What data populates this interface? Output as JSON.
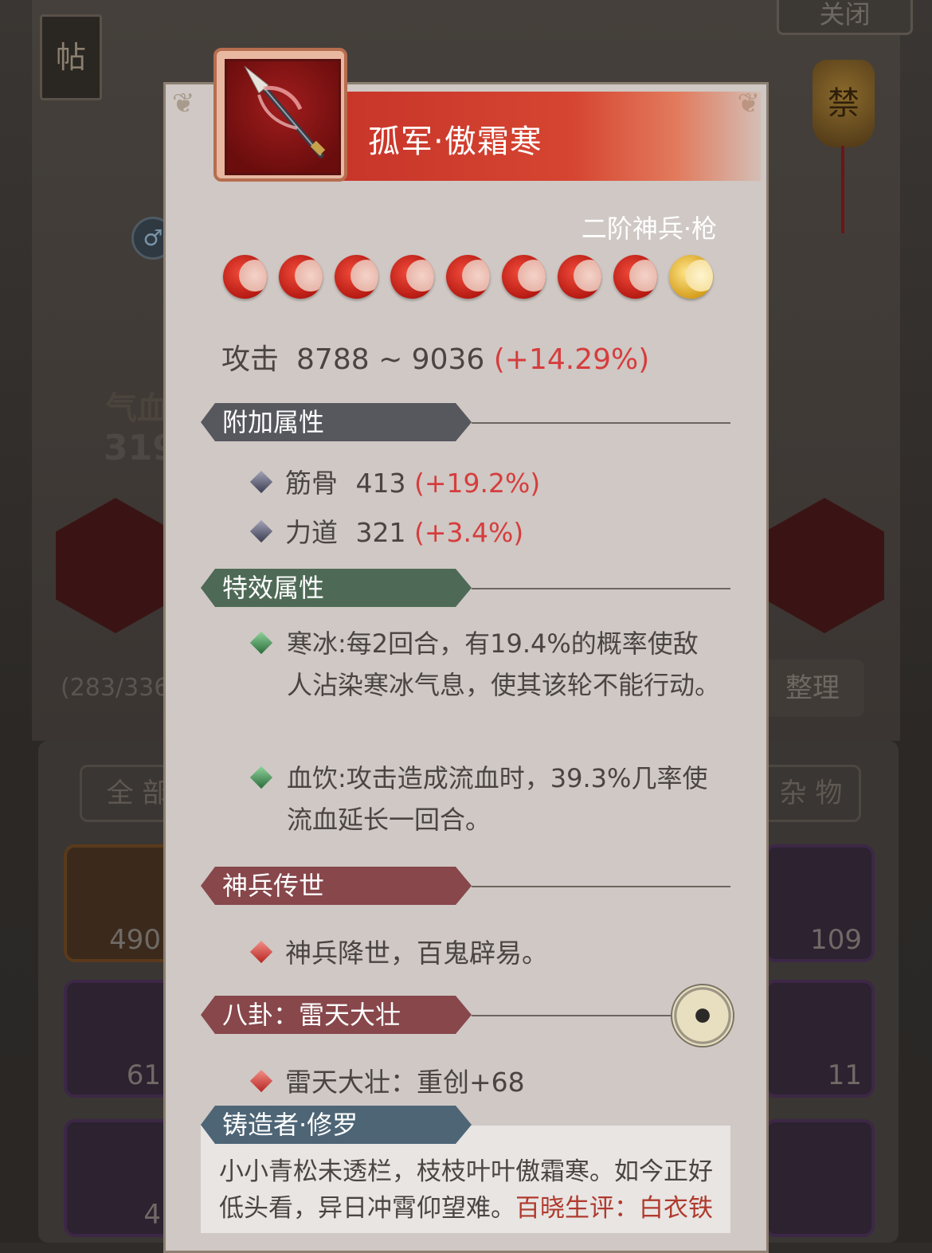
{
  "background": {
    "close_label": "关闭",
    "tie_label": "帖",
    "ban_label": "禁",
    "gender_symbol": "♂",
    "hp_label": "气血",
    "hp_value": "319",
    "ratio": "(283/336",
    "tidy_label": "整理",
    "tab_all": "全 部",
    "tab_misc": "杂 物",
    "slot_counts": [
      "490",
      "109",
      "61",
      "11",
      "4"
    ]
  },
  "item": {
    "name": "孤军·傲霜寒",
    "subtitle": "二阶神兵·枪",
    "stars": {
      "filled": 8,
      "total": 9
    },
    "attack": {
      "label": "攻击",
      "range": "8788 ~ 9036",
      "bonus": "(+14.29%)"
    }
  },
  "sections": {
    "extra": {
      "title": "附加属性",
      "stats": [
        {
          "name": "筋骨",
          "value": "413",
          "bonus": "(+19.2%)"
        },
        {
          "name": "力道",
          "value": "321",
          "bonus": "(+3.4%)"
        }
      ]
    },
    "effects": {
      "title": "特效属性",
      "items": [
        "寒冰:每2回合，有19.4%的概率使敌人沾染寒冰气息，使其该轮不能行动。",
        "血饮:攻击造成流血时，39.3%几率使流血延长一回合。"
      ]
    },
    "legend": {
      "title": "神兵传世",
      "text": "神兵降世，百鬼辟易。"
    },
    "bagua": {
      "title": "八卦：雷天大壮",
      "text": "雷天大壮：重创+68"
    },
    "forger": {
      "title": "铸造者·修罗",
      "poem": "小小青松未透栏，枝枝叶叶傲霜寒。如今正好低头看，异日冲霄仰望难。",
      "comment": "百晓生评：白衣铁"
    }
  },
  "colors": {
    "title_bar": "#d64531",
    "bonus_red": "#d63d3d",
    "card_bg": "#cfc8c4"
  },
  "icons": [
    "spear-icon",
    "diamond-bullet-icon",
    "bagua-icon",
    "red-moon-star-icon",
    "gold-moon-star-icon"
  ]
}
